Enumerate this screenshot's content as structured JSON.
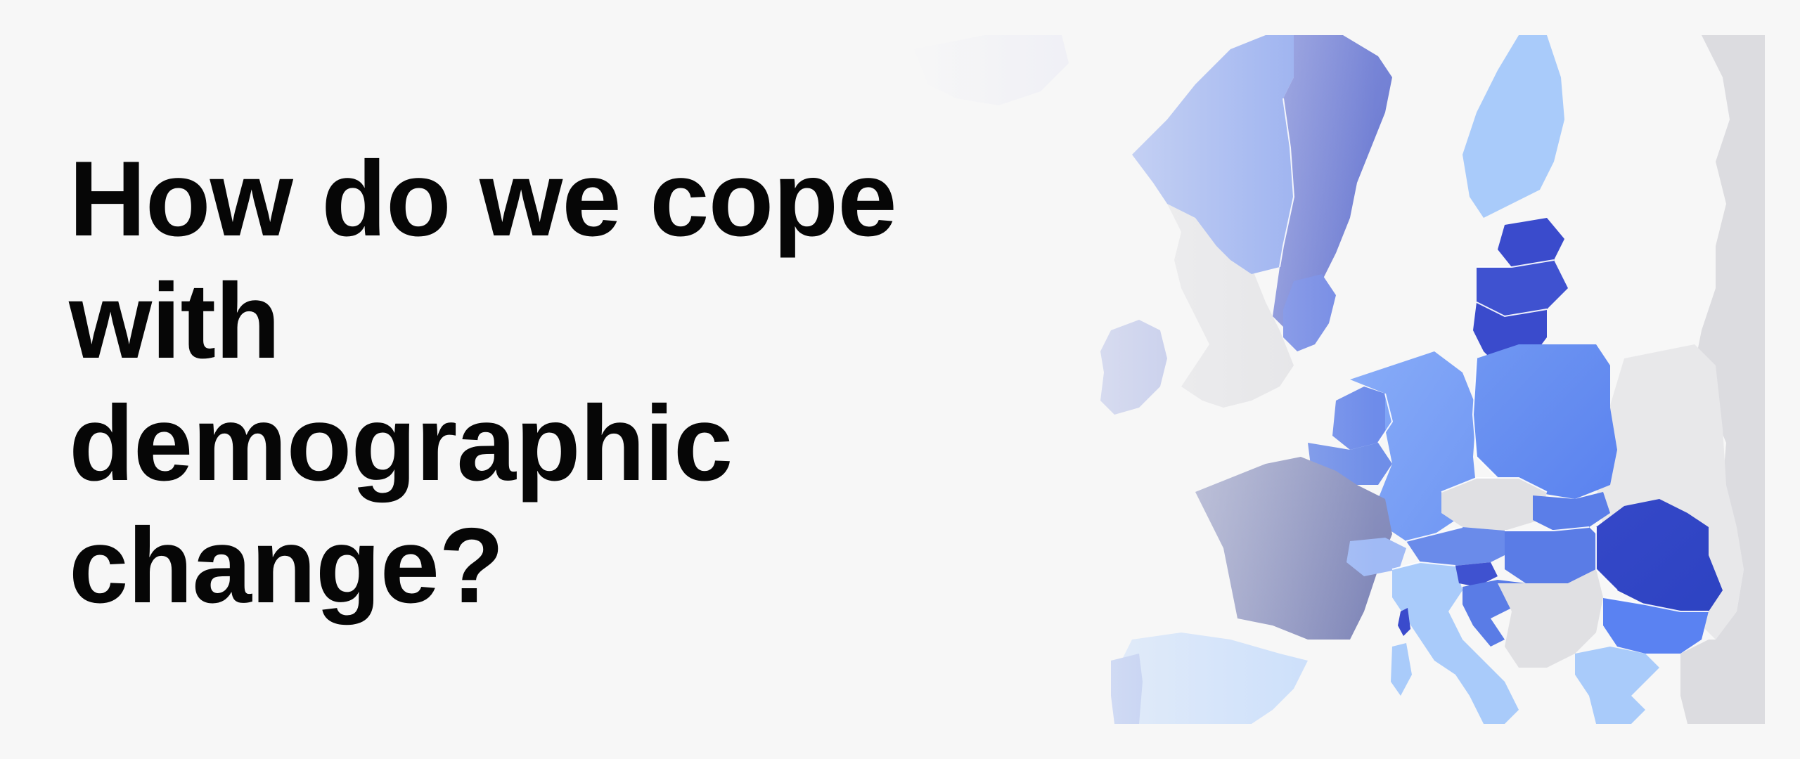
{
  "headline": {
    "line1": "How do we cope",
    "line2": "with",
    "line3": "demographic",
    "line4": "change?"
  },
  "map": {
    "description_name": "europe-choropleth",
    "colors": {
      "background_sea": "#f7f7f7",
      "non_eu": "#e6e6e8",
      "light_blue": "#c6dcfb",
      "sky_blue": "#a9cbfa",
      "medium_blue": "#86a9f7",
      "bright_blue": "#5c86f1",
      "slate_blue": "#7381d4",
      "deep_blue": "#3a4bcc",
      "grey_violet": "#8f95c0",
      "pale_violet": "#b0b9e8",
      "right_edge": "#dcdce0"
    }
  }
}
